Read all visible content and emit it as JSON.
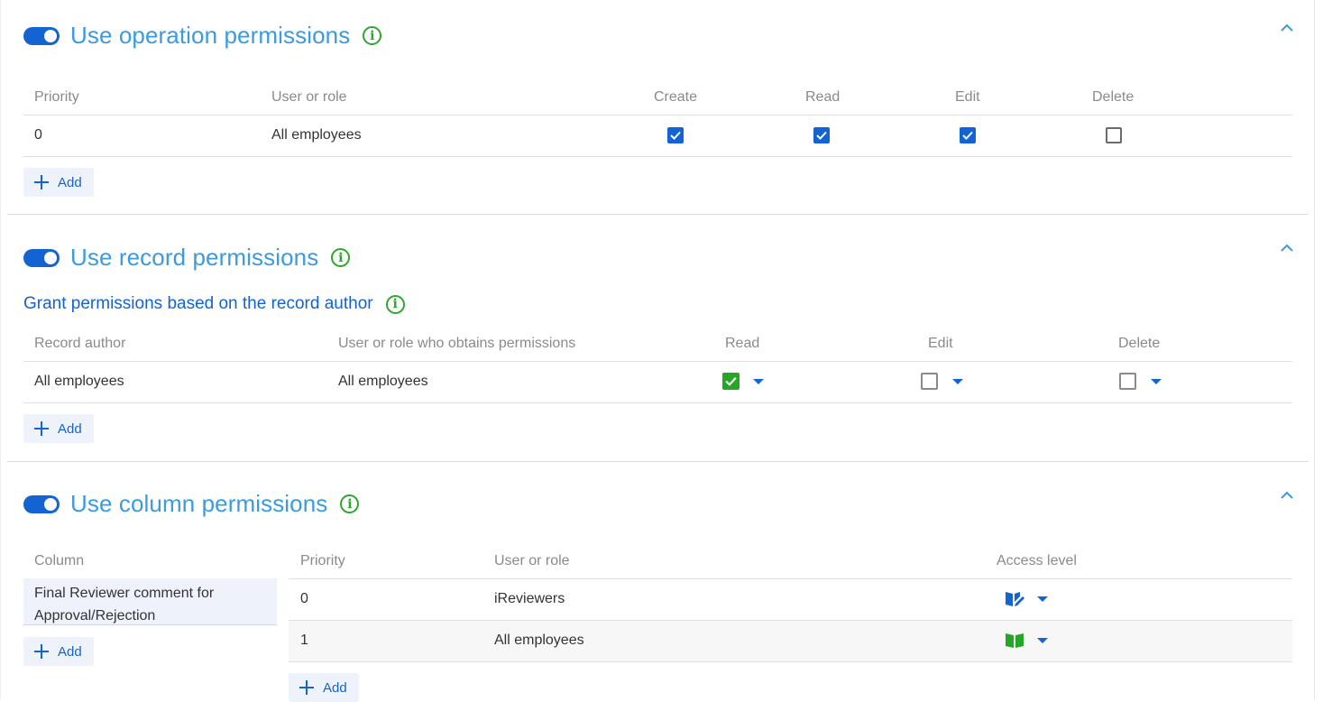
{
  "operation": {
    "title": "Use operation permissions",
    "headers": [
      "Priority",
      "User or role",
      "Create",
      "Read",
      "Edit",
      "Delete"
    ],
    "rows": [
      {
        "priority": "0",
        "user": "All employees",
        "create": true,
        "read": true,
        "edit": true,
        "delete": false
      }
    ],
    "add_label": "Add"
  },
  "record": {
    "title": "Use record permissions",
    "subtitle": "Grant permissions based on the record author",
    "headers": [
      "Record author",
      "User or role who obtains permissions",
      "Read",
      "Edit",
      "Delete"
    ],
    "rows": [
      {
        "author": "All employees",
        "user": "All employees",
        "read": true,
        "edit": false,
        "delete": false
      }
    ],
    "add_label": "Add"
  },
  "column": {
    "title": "Use column permissions",
    "left_header": "Column",
    "columns": [
      "Final Reviewer comment for Approval/Rejection"
    ],
    "headers": [
      "Priority",
      "User or role",
      "Access level"
    ],
    "rows": [
      {
        "priority": "0",
        "user": "iReviewers",
        "access_icon": "read-edit-icon"
      },
      {
        "priority": "1",
        "user": "All employees",
        "access_icon": "read-book-icon"
      }
    ],
    "add_left_label": "Add",
    "add_right_label": "Add"
  },
  "colors": {
    "accent": "#1463d3",
    "title": "#3a9be0",
    "info": "#2ba82b",
    "check_green": "#26a626"
  },
  "icons": {
    "toggle": "toggle-on-icon",
    "info": "info-icon",
    "collapse": "chevron-up-icon",
    "dropdown": "caret-down-icon",
    "add": "plus-icon"
  }
}
